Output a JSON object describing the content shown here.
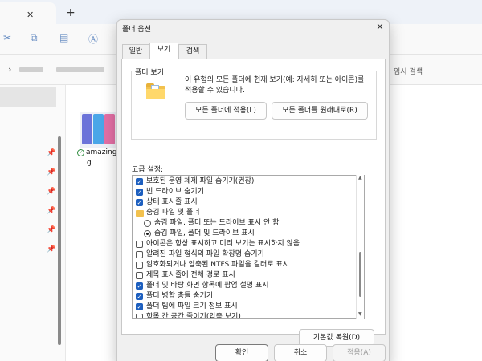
{
  "explorer": {
    "tab_close": "✕",
    "tab_new": "+",
    "search_hint": "임시 검색",
    "file_name_line1": "amazing_",
    "file_name_line2": "g",
    "file_check": "✓"
  },
  "dialog": {
    "title": "폴더 옵션",
    "close": "✕",
    "tabs": [
      "일반",
      "보기",
      "검색"
    ],
    "active_tab": "보기",
    "folder_view": {
      "group_label": "폴더 보기",
      "description": "이 유형의 모든 폴더에 현재 보기(예: 자세히 또는 아이콘)를 적용할 수 있습니다.",
      "apply_button": "모든 폴더에 적용(L)",
      "reset_button": "모든 폴더를 원래대로(R)"
    },
    "advanced": {
      "label": "고급 설정:",
      "items": [
        {
          "type": "checkbox",
          "checked": true,
          "indent": 0,
          "label": "보호된 운영 체제 파일 숨기기(권장)"
        },
        {
          "type": "checkbox",
          "checked": true,
          "indent": 0,
          "label": "빈 드라이브 숨기기"
        },
        {
          "type": "checkbox",
          "checked": true,
          "indent": 0,
          "label": "상태 표시줄 표시"
        },
        {
          "type": "folder",
          "checked": false,
          "indent": 0,
          "label": "숨김 파일 및 폴더"
        },
        {
          "type": "radio",
          "checked": false,
          "indent": 1,
          "label": "숨김 파일, 폴더 또는 드라이브 표시 안 함"
        },
        {
          "type": "radio",
          "checked": true,
          "indent": 1,
          "label": "숨김 파일, 폴더 및 드라이브 표시"
        },
        {
          "type": "checkbox",
          "checked": false,
          "indent": 0,
          "label": "아이콘은 항상 표시하고 미리 보기는 표시하지 않음"
        },
        {
          "type": "checkbox",
          "checked": false,
          "indent": 0,
          "label": "알려진 파일 형식의 파일 확장명 숨기기"
        },
        {
          "type": "checkbox",
          "checked": false,
          "indent": 0,
          "label": "암호화되거나 압축된 NTFS 파일을 컬러로 표시"
        },
        {
          "type": "checkbox",
          "checked": false,
          "indent": 0,
          "label": "제목 표시줄에 전체 경로 표시"
        },
        {
          "type": "checkbox",
          "checked": true,
          "indent": 0,
          "label": "폴더 및 바탕 화면 항목에 팝업 설명 표시"
        },
        {
          "type": "checkbox",
          "checked": true,
          "indent": 0,
          "label": "폴더 병합 충돌 숨기기"
        },
        {
          "type": "checkbox",
          "checked": true,
          "indent": 0,
          "label": "폴더 팁에 파일 크기 정보 표시"
        },
        {
          "type": "checkbox",
          "checked": false,
          "indent": 0,
          "label": "항목 간 공간 줄이기(압축 보기)"
        }
      ],
      "restore_button": "기본값 복원(D)"
    },
    "ok_button": "확인",
    "cancel_button": "취소",
    "apply_button": "적용(A)"
  }
}
